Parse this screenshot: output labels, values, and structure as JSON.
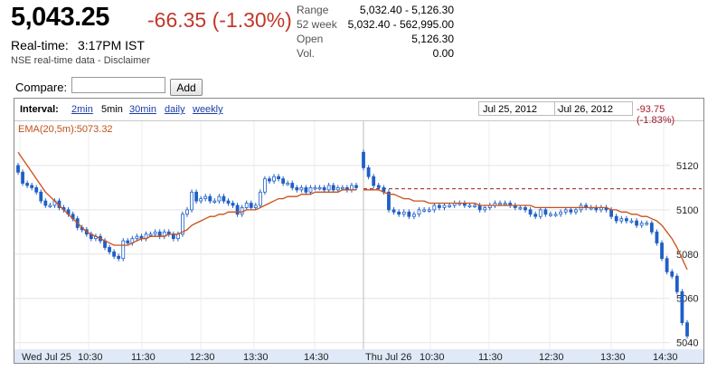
{
  "header": {
    "price": "5,043.25",
    "change": "-66.35 (-1.30%)",
    "realtime_label": "Real-time:",
    "realtime_time": "3:17PM IST",
    "source_note": "NSE real-time data - Disclaimer"
  },
  "stats": [
    {
      "label": "Range",
      "value": "5,032.40 - 5,126.30"
    },
    {
      "label": "52 week",
      "value": "5,032.40 - 562,995.00"
    },
    {
      "label": "Open",
      "value": "5,126.30"
    },
    {
      "label": "Vol.",
      "value": "0.00"
    }
  ],
  "compare": {
    "label": "Compare:",
    "placeholder": "",
    "add_label": "Add"
  },
  "toolbar": {
    "interval_label": "Interval:",
    "options": [
      "2min",
      "5min",
      "30min",
      "daily",
      "weekly"
    ],
    "selected": "5min",
    "date_from": "Jul 25, 2012",
    "date_sep": "-",
    "date_to": "Jul 26, 2012",
    "range_change": "-93.75 (-1.83%)"
  },
  "colors": {
    "down": "#c0392b",
    "candle": "#1f5fc7",
    "ema": "#c8501a",
    "prev_close": "#a01c2c",
    "axis_bg": "#dfe9f7"
  },
  "chart_data": {
    "type": "candlestick",
    "ema_label": "EMA(20,5m):5073.32",
    "ylim": [
      5037,
      5140
    ],
    "y_ticks": [
      5040,
      5060,
      5080,
      5100,
      5120
    ],
    "prev_close": 5109.5,
    "x_labels": [
      "Wed Jul 25",
      "10:30",
      "11:30",
      "12:30",
      "13:30",
      "14:30",
      "Thu Jul 26",
      "10:30",
      "11:30",
      "12:30",
      "13:30",
      "14:30"
    ],
    "day1_close": [
      5117,
      5112,
      5111,
      5110,
      5108,
      5104,
      5102,
      5102,
      5104,
      5101,
      5100,
      5098,
      5096,
      5092,
      5091,
      5089,
      5087,
      5088,
      5086,
      5083,
      5081,
      5079,
      5078,
      5086,
      5085,
      5087,
      5088,
      5087,
      5089,
      5089,
      5090,
      5088,
      5090,
      5089,
      5087,
      5089,
      5098,
      5100,
      5108,
      5104,
      5105,
      5106,
      5104,
      5104,
      5106,
      5104,
      5103,
      5102,
      5098,
      5101,
      5103,
      5101,
      5102,
      5108,
      5114,
      5113,
      5115,
      5114,
      5112,
      5112,
      5110,
      5109,
      5110,
      5108,
      5110,
      5110,
      5110,
      5109,
      5111,
      5109,
      5110,
      5110,
      5109,
      5111,
      5110
    ],
    "day2_close": [
      5119,
      5115,
      5111,
      5110,
      5108,
      5100,
      5099,
      5098,
      5099,
      5097,
      5098,
      5100,
      5100,
      5100,
      5102,
      5101,
      5102,
      5102,
      5103,
      5103,
      5102,
      5102,
      5102,
      5100,
      5101,
      5102,
      5103,
      5103,
      5103,
      5102,
      5101,
      5101,
      5100,
      5098,
      5097,
      5100,
      5098,
      5098,
      5098,
      5099,
      5100,
      5099,
      5100,
      5102,
      5101,
      5101,
      5100,
      5101,
      5100,
      5097,
      5095,
      5096,
      5095,
      5095,
      5093,
      5094,
      5094,
      5090,
      5085,
      5078,
      5072,
      5070,
      5063,
      5049,
      5043
    ],
    "ema_day1": [
      5126,
      5123,
      5120,
      5117,
      5114,
      5111,
      5108,
      5106,
      5104,
      5102,
      5100,
      5098,
      5096,
      5094,
      5092,
      5090,
      5089,
      5088,
      5087,
      5086,
      5085,
      5084,
      5084,
      5084,
      5084,
      5085,
      5086,
      5087,
      5087,
      5088,
      5088,
      5088,
      5088,
      5089,
      5089,
      5089,
      5090,
      5091,
      5093,
      5094,
      5095,
      5096,
      5097,
      5097,
      5098,
      5098,
      5099,
      5099,
      5099,
      5099,
      5100,
      5100,
      5100,
      5101,
      5102,
      5103,
      5104,
      5105,
      5105,
      5106,
      5106,
      5106,
      5107,
      5107,
      5107,
      5108,
      5108,
      5108,
      5108,
      5108,
      5108,
      5109,
      5109,
      5109,
      5109
    ],
    "ema_day2": [
      5109,
      5109,
      5109,
      5109,
      5108,
      5107,
      5107,
      5106,
      5105,
      5105,
      5104,
      5104,
      5104,
      5103,
      5103,
      5103,
      5103,
      5103,
      5103,
      5103,
      5103,
      5103,
      5103,
      5102,
      5102,
      5102,
      5102,
      5102,
      5102,
      5102,
      5102,
      5102,
      5102,
      5102,
      5101,
      5101,
      5101,
      5101,
      5101,
      5101,
      5101,
      5101,
      5101,
      5101,
      5101,
      5101,
      5101,
      5101,
      5101,
      5100,
      5100,
      5099,
      5099,
      5098,
      5098,
      5097,
      5097,
      5096,
      5095,
      5093,
      5090,
      5087,
      5083,
      5078,
      5073
    ]
  }
}
